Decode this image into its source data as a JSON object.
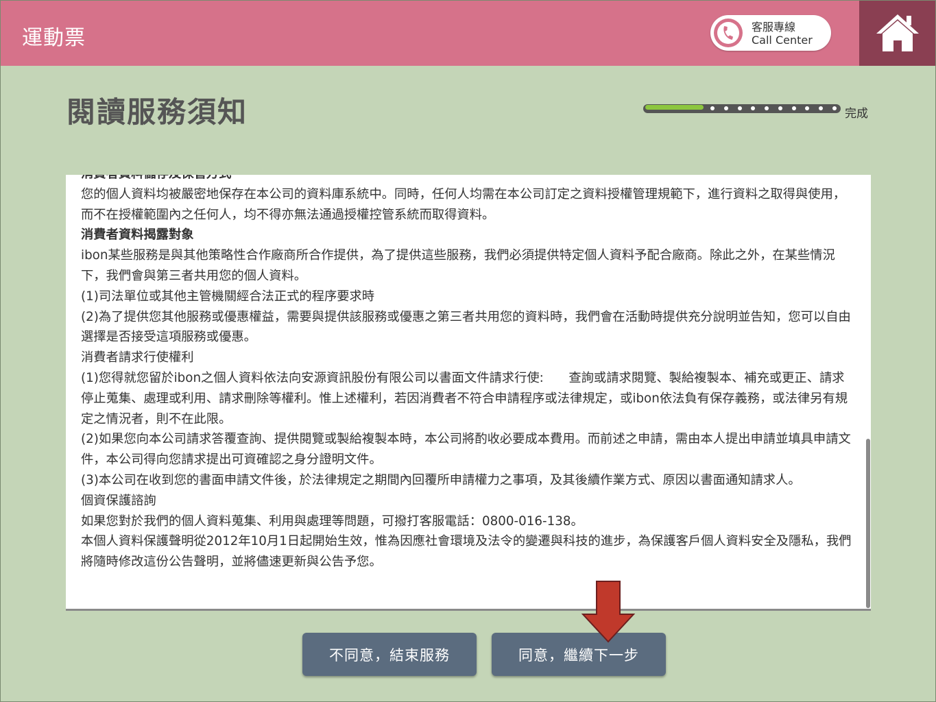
{
  "header": {
    "title": "運動票",
    "call_center_zh": "客服專線",
    "call_center_en": "Call Center",
    "phone_icon": "phone-icon",
    "home_icon": "home-icon"
  },
  "page": {
    "title": "閱讀服務須知"
  },
  "progress": {
    "label": "完成",
    "fraction": 0.3
  },
  "content": {
    "paragraphs": [
      {
        "text": "消費者資料儲存及保管方式",
        "bold": true
      },
      {
        "text": "您的個人資料均被嚴密地保存在本公司的資料庫系統中。同時，任何人均需在本公司訂定之資料授權管理規範下，進行資料之取得與使用，而不在授權範圍內之任何人，均不得亦無法通過授權控管系統而取得資料。",
        "bold": false
      },
      {
        "text": "消費者資料揭露對象",
        "bold": true
      },
      {
        "text": "ibon某些服務是與其他策略性合作廠商所合作提供，為了提供這些服務，我們必須提供特定個人資料予配合廠商。除此之外，在某些情況下，我們會與第三者共用您的個人資料。",
        "bold": false
      },
      {
        "text": "(1)司法單位或其他主管機關經合法正式的程序要求時",
        "bold": false
      },
      {
        "text": "(2)為了提供您其他服務或優惠權益，需要與提供該服務或優惠之第三者共用您的資料時，我們會在活動時提供充分說明並告知，您可以自由選擇是否接受這項服務或優惠。",
        "bold": false
      },
      {
        "text": "消費者請求行使權利",
        "bold": false
      },
      {
        "text": "(1)您得就您留於ibon之個人資料依法向安源資訊股份有限公司以書面文件請求行使:　　查詢或請求閱覽、製給複製本、補充或更正、請求停止蒐集、處理或利用、請求刪除等權利。惟上述權利，若因消費者不符合申請程序或法律規定，或ibon依法負有保存義務，或法律另有規定之情況者，則不在此限。",
        "bold": false
      },
      {
        "text": "(2)如果您向本公司請求答覆查詢、提供閱覽或製給複製本時，本公司將酌收必要成本費用。而前述之申請，需由本人提出申請並填具申請文件，本公司得向您請求提出可資確認之身分證明文件。",
        "bold": false
      },
      {
        "text": "(3)本公司在收到您的書面申請文件後，於法律規定之期間內回覆所申請權力之事項，及其後續作業方式、原因以書面通知請求人。",
        "bold": false
      },
      {
        "text": "個資保護諮詢",
        "bold": false
      },
      {
        "text": "如果您對於我們的個人資料蒐集、利用與處理等問題，可撥打客服電話：0800-016-138。",
        "bold": false
      },
      {
        "text": "本個人資料保護聲明從2012年10月1日起開始生效，惟為因應社會環境及法令的變遷與科技的進步，為保護客戶個人資料安全及隱私，我們將隨時修改這份公告聲明，並將儘速更新與公告予您。",
        "bold": false
      }
    ]
  },
  "buttons": {
    "disagree": "不同意，結束服務",
    "agree": "同意，繼續下一步"
  },
  "annotation": {
    "arrow_color": "#c0392b"
  }
}
